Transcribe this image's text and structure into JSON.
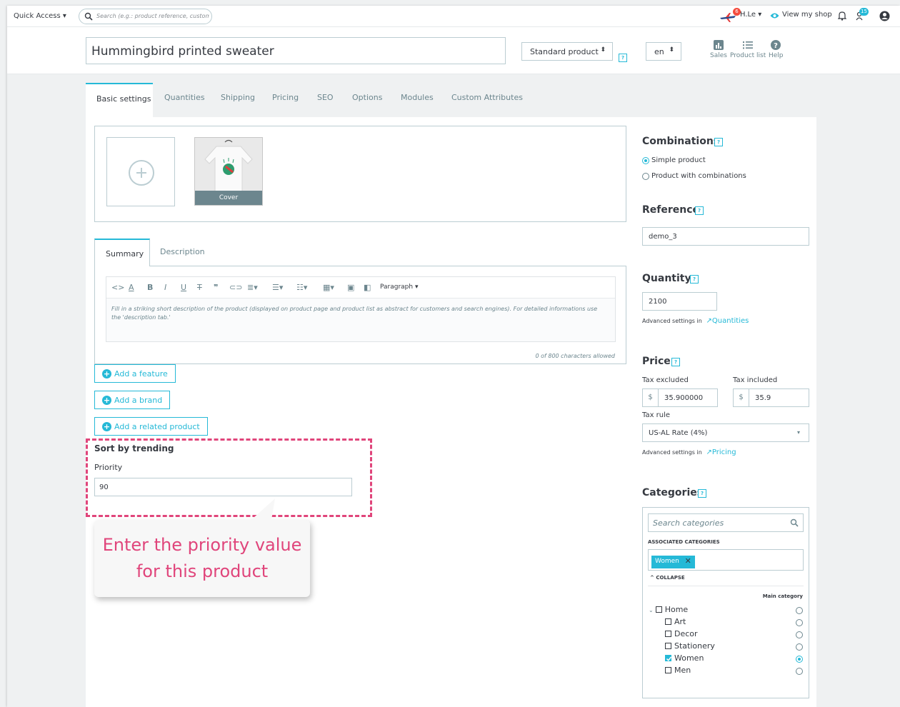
{
  "topbar": {
    "quick_access": "Quick Access ▾",
    "search_placeholder": "Search (e.g.: product reference, custome",
    "user": "H.Le ▾",
    "view_shop": "View my shop",
    "notif_count": "6",
    "messages_count": "15"
  },
  "header": {
    "product_name": "Hummingbird printed sweater",
    "product_type": "Standard product",
    "language": "en",
    "sales_label": "Sales",
    "product_list_label": "Product list",
    "help_label": "Help"
  },
  "tabs": [
    "Basic settings",
    "Quantities",
    "Shipping",
    "Pricing",
    "SEO",
    "Options",
    "Modules",
    "Custom Attributes"
  ],
  "images": {
    "cover_label": "Cover"
  },
  "summary": {
    "tab_summary": "Summary",
    "tab_description": "Description",
    "paragraph_label": "Paragraph ▾",
    "placeholder": "Fill in a striking short description of the product (displayed on product page and product list as abstract for customers and search engines). For detailed informations use the 'description tab.'",
    "counter": "0 of 800 characters allowed"
  },
  "buttons": {
    "add_feature": "Add a feature",
    "add_brand": "Add a brand",
    "add_related": "Add a related product"
  },
  "trending": {
    "title": "Sort by trending",
    "priority_label": "Priority",
    "priority_value": "90"
  },
  "callout": {
    "line1": "Enter the priority value",
    "line2": "for this product"
  },
  "combinations": {
    "title": "Combinations",
    "simple": "Simple product",
    "with_combinations": "Product with combinations"
  },
  "reference": {
    "title": "Reference",
    "value": "demo_3"
  },
  "quantity": {
    "title": "Quantity",
    "value": "2100",
    "advanced": "Advanced settings in",
    "link": "Quantities"
  },
  "price": {
    "title": "Price",
    "tax_excluded_label": "Tax excluded",
    "tax_included_label": "Tax included",
    "currency": "$",
    "tax_excluded": "35.900000",
    "tax_included": "35.9",
    "tax_rule_label": "Tax rule",
    "tax_rule": "US-AL Rate (4%)",
    "advanced": "Advanced settings in",
    "link": "Pricing"
  },
  "categories": {
    "title": "Categories",
    "search_placeholder": "Search categories",
    "associated": "ASSOCIATED CATEGORIES",
    "tag": "Women",
    "collapse": "COLLAPSE",
    "main_category": "Main category",
    "tree": [
      "Home",
      "Art",
      "Decor",
      "Stationery",
      "Women",
      "Men"
    ]
  }
}
